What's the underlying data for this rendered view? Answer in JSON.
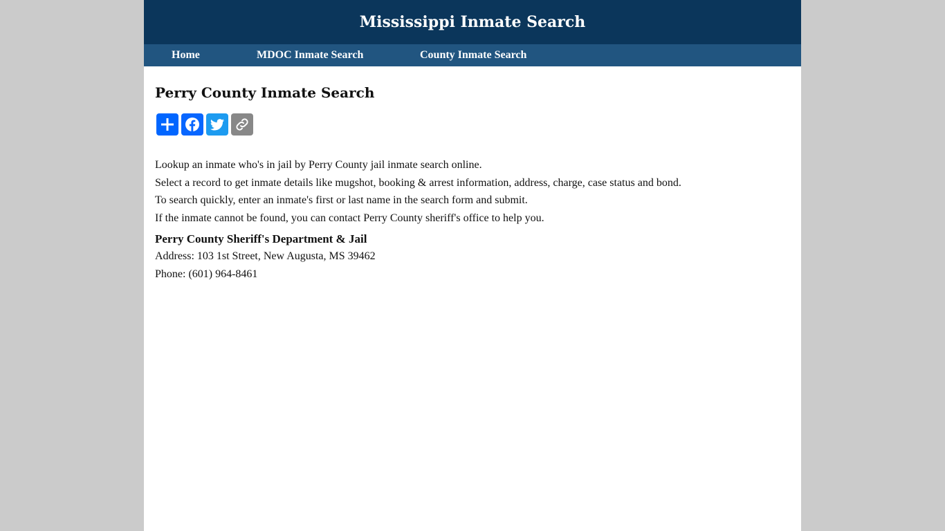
{
  "header": {
    "title": "Mississippi Inmate Search"
  },
  "nav": {
    "items": [
      {
        "label": "Home"
      },
      {
        "label": "MDOC Inmate Search"
      },
      {
        "label": "County Inmate Search"
      }
    ]
  },
  "main": {
    "heading": "Perry County Inmate Search",
    "share_buttons": [
      {
        "icon": "share-plus-icon",
        "color": "#0166ff"
      },
      {
        "icon": "facebook-icon",
        "color": "#0866ff"
      },
      {
        "icon": "twitter-icon",
        "color": "#1d9bf0"
      },
      {
        "icon": "copy-link-icon",
        "color": "#888888"
      }
    ],
    "intro_lines": [
      "Lookup an inmate who's in jail by Perry County jail inmate search online.",
      "Select a record to get inmate details like mugshot, booking & arrest information, address, charge, case status and bond.",
      "To search quickly, enter an inmate's first or last name in the search form and submit.",
      "If the inmate cannot be found, you can contact Perry County sheriff's office to help you."
    ],
    "sheriff": {
      "name": "Perry County Sheriff's Department & Jail",
      "address": "Address: 103 1st Street, New Augusta, MS 39462",
      "phone": "Phone: (601) 964-8461"
    }
  },
  "colors": {
    "header_bg": "#0b365b",
    "nav_bg": "#215580",
    "page_bg": "#cbcbcb"
  }
}
